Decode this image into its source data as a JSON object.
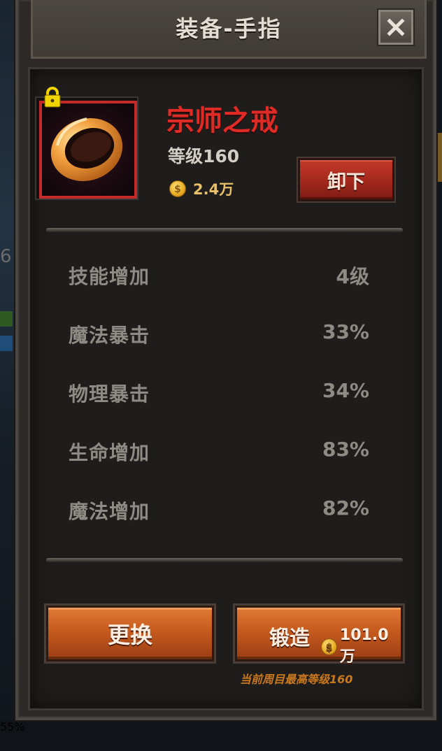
{
  "dialog": {
    "title": "装备-手指",
    "close_icon": "close-icon"
  },
  "item": {
    "name": "宗师之戒",
    "level": "等级160",
    "price": "2.4万",
    "price_icon": "gold-coin-icon",
    "lock_icon": "lock-icon",
    "image_icon": "ring-icon",
    "name_color": "#e02a26",
    "frame_color": "#c52a2a"
  },
  "actions": {
    "unequip_label": "卸下",
    "replace_label": "更换",
    "forge_label": "锻造",
    "forge_cost": "101.0万",
    "forge_cost_icon": "gold-coin-icon"
  },
  "stats": [
    {
      "name": "技能增加",
      "value": "4级"
    },
    {
      "name": "魔法暴击",
      "value": "33%"
    },
    {
      "name": "物理暴击",
      "value": "34%"
    },
    {
      "name": "生命增加",
      "value": "83%"
    },
    {
      "name": "魔法增加",
      "value": "82%"
    }
  ],
  "footnote": "当前周目最高等级160",
  "background": {
    "left_edge_number": "6",
    "bottom_peek_text": "55%"
  }
}
